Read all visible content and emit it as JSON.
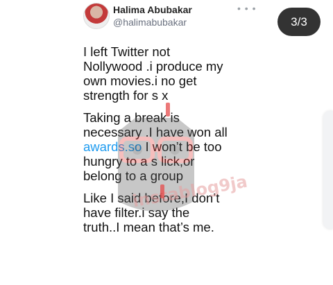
{
  "author": {
    "display_name": "Halima Abubakar",
    "handle": "@halimabubakar"
  },
  "more_icon": "more-horizontal-icon",
  "tweet": {
    "para1": "I left Twitter not\nNollywood .i produce my\nown movies.i no get\nstrength for s  x",
    "para2_a": "Taking a break is\nnecessary .I have won all\n",
    "para2_link": "awards.so",
    "para2_b": " I won’t be too\nhungry to a  s lick,or\nbelong to a group",
    "para3": "Like I said before,I don’t\nhave filter.i say the\ntruth..I mean that’s me."
  },
  "pager": {
    "label": "3/3"
  },
  "watermark": {
    "text": "instablog9ja"
  },
  "colors": {
    "link": "#1d9bf0",
    "badge_bg": "#333333",
    "censor": "#e54b4b"
  }
}
